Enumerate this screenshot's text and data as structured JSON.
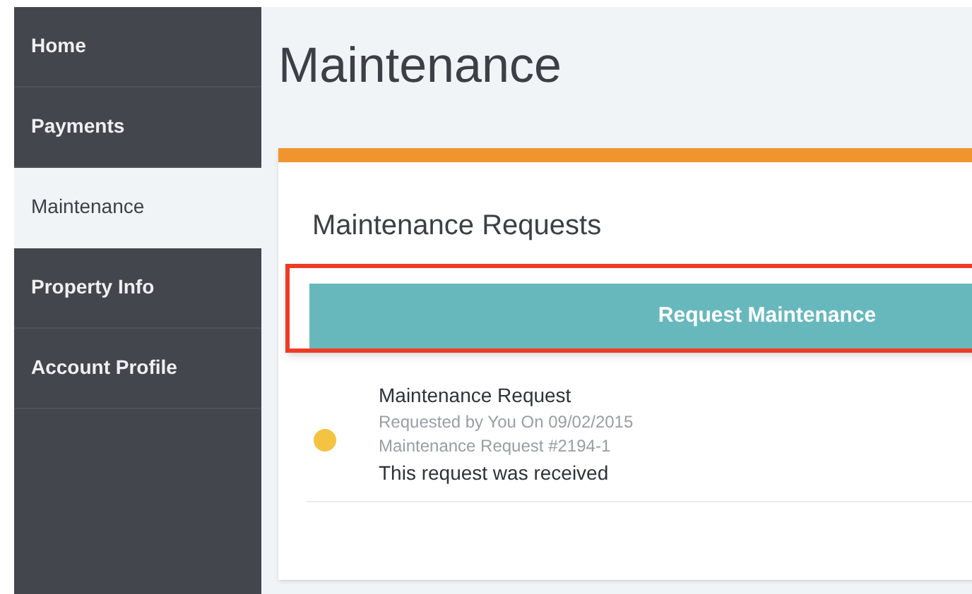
{
  "sidebar": {
    "items": [
      {
        "label": "Home",
        "selected": false
      },
      {
        "label": "Payments",
        "selected": false
      },
      {
        "label": "Maintenance",
        "selected": true
      },
      {
        "label": "Property Info",
        "selected": false
      },
      {
        "label": "Account Profile",
        "selected": false
      }
    ]
  },
  "page_title": "Maintenance",
  "card": {
    "title": "Maintenance Requests",
    "button": {
      "label": "Request Maintenance",
      "highlighted": true
    },
    "requests": [
      {
        "title": "Maintenance Request",
        "requested_by": "Requested by You On 09/02/2015",
        "number": "Maintenance Request #2194-1",
        "status": "This request was received",
        "color": "#f5c342"
      }
    ]
  }
}
